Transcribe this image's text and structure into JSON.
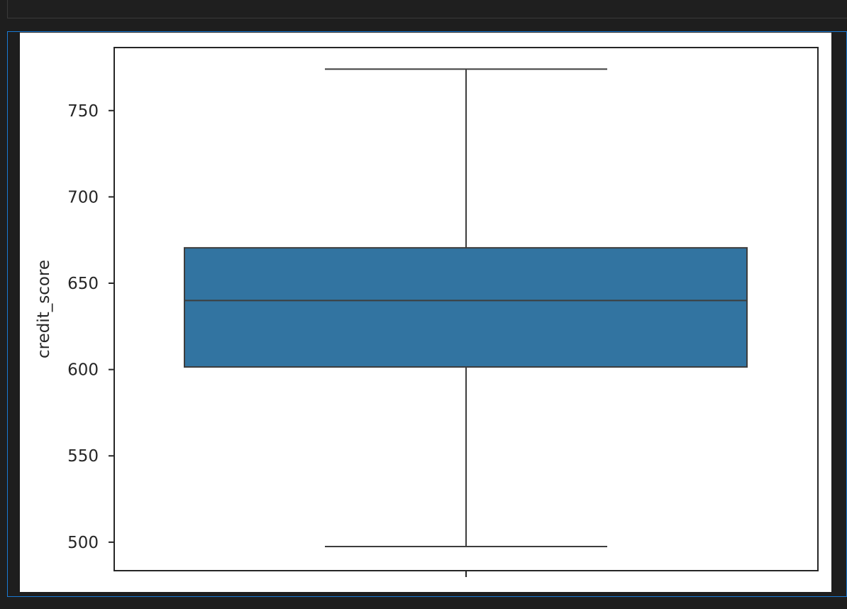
{
  "colors": {
    "box_fill": "#3274a1",
    "box_edge": "#3d3d3d",
    "axes_edge": "#262626",
    "cell_border": "#1a7ad4"
  },
  "chart_data": {
    "type": "box",
    "title": "",
    "xlabel": "",
    "ylabel": "credit_score",
    "ylim": [
      483.5,
      786.5
    ],
    "yticks": [
      500,
      550,
      600,
      650,
      700,
      750
    ],
    "grid": false,
    "box": {
      "whisker_low": 497.5,
      "q1": 601.5,
      "median": 640,
      "q3": 670.5,
      "whisker_high": 774
    }
  }
}
